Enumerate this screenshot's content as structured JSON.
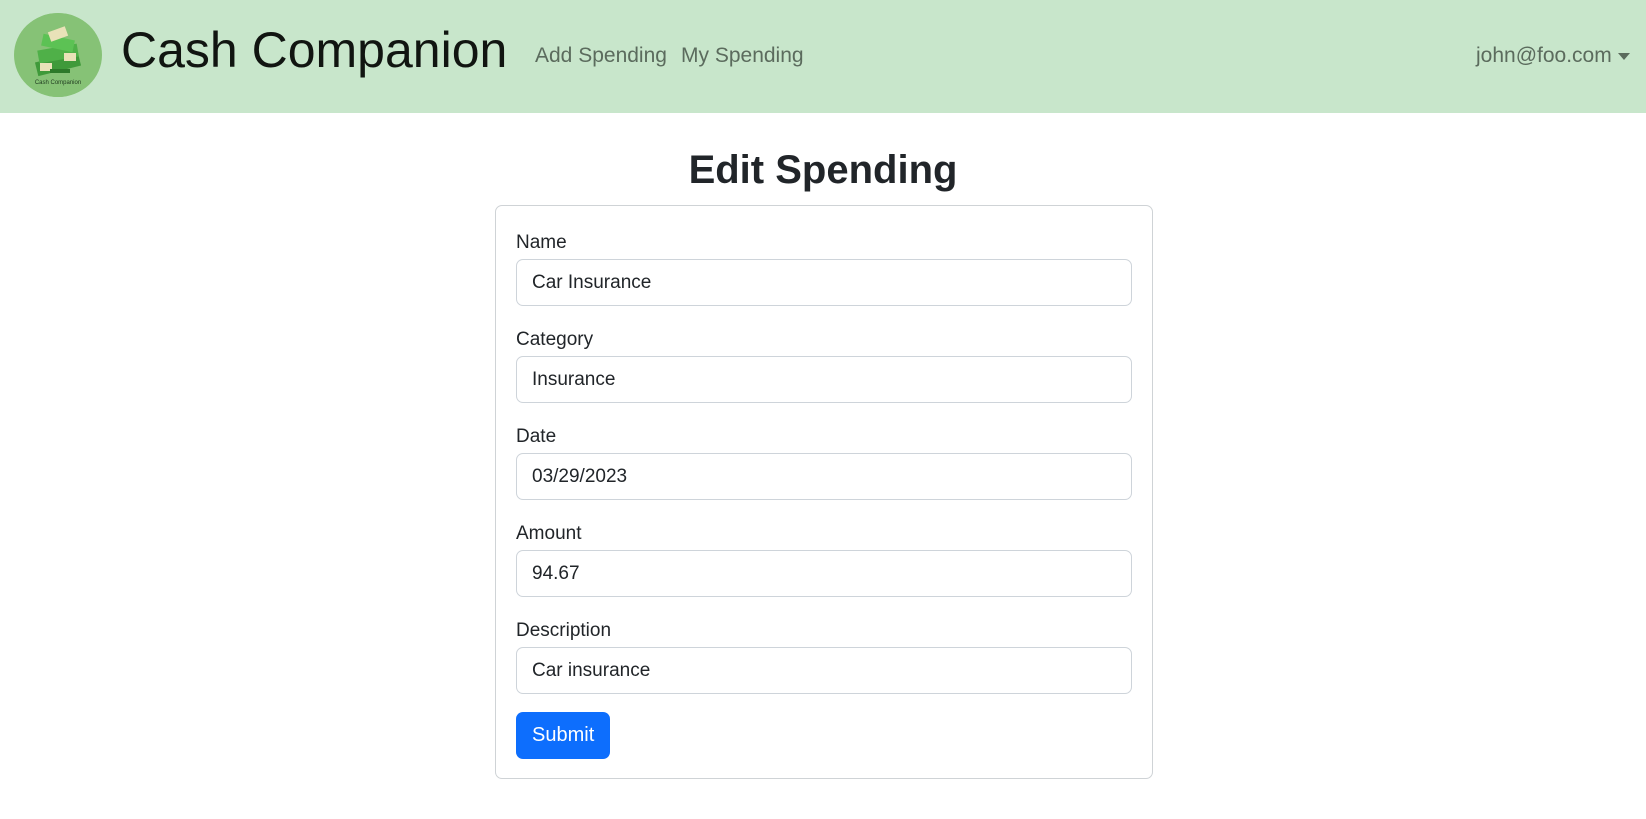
{
  "navbar": {
    "brand": "Cash Companion",
    "logo_text": "Cash Companion",
    "links": [
      {
        "label": "Add Spending"
      },
      {
        "label": "My Spending"
      }
    ],
    "user_email": "john@foo.com",
    "background": "#c8e6cb"
  },
  "page": {
    "title": "Edit Spending"
  },
  "form": {
    "fields": [
      {
        "label": "Name",
        "value": "Car Insurance"
      },
      {
        "label": "Category",
        "value": "Insurance"
      },
      {
        "label": "Date",
        "value": "03/29/2023"
      },
      {
        "label": "Amount",
        "value": "94.67"
      },
      {
        "label": "Description",
        "value": "Car insurance"
      }
    ],
    "submit_label": "Submit",
    "accent": "#0d6efd"
  }
}
